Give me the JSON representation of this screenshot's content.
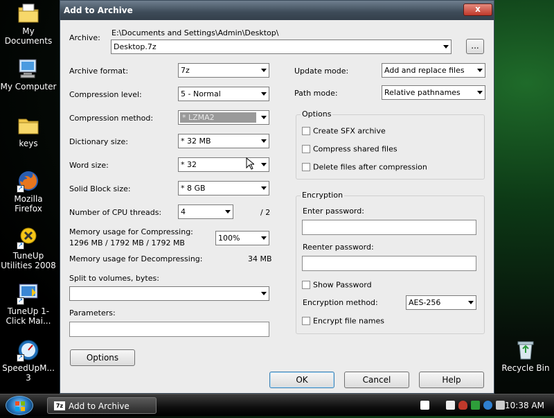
{
  "desktop": {
    "icons": [
      {
        "label": "My Documents",
        "icon": "my-documents-icon"
      },
      {
        "label": "My Computer",
        "icon": "my-computer-icon"
      },
      {
        "label": "keys",
        "icon": "folder-icon"
      },
      {
        "label": "Mozilla Firefox",
        "icon": "firefox-icon"
      },
      {
        "label": "TuneUp Utilities 2008",
        "icon": "tuneup-icon"
      },
      {
        "label": "TuneUp 1-Click Mai...",
        "icon": "tuneup-1click-icon"
      },
      {
        "label": "SpeedUpM... 3",
        "icon": "speedup-icon"
      },
      {
        "label": "Recycle Bin",
        "icon": "recycle-bin-icon"
      }
    ]
  },
  "dialog": {
    "title": "Add to Archive",
    "close_label": "x",
    "archive_label": "Archive:",
    "archive_path": "E:\\Documents and Settings\\Admin\\Desktop\\",
    "archive_name": "Desktop.7z",
    "browse_label": "...",
    "left": {
      "archive_format": {
        "label": "Archive format:",
        "value": "7z"
      },
      "compression_level": {
        "label": "Compression level:",
        "value": "5 - Normal"
      },
      "compression_method": {
        "label": "Compression method:",
        "value": "* LZMA2"
      },
      "dictionary_size": {
        "label": "Dictionary size:",
        "value": "* 32 MB"
      },
      "word_size": {
        "label": "Word size:",
        "value": "* 32"
      },
      "solid_block_size": {
        "label": "Solid Block size:",
        "value": "* 8 GB"
      },
      "cpu_threads": {
        "label": "Number of CPU threads:",
        "value": "4",
        "max": "/ 2"
      },
      "memory_compress": {
        "label": "Memory usage for Compressing:",
        "detail": "1296 MB / 1792 MB / 1792 MB",
        "value": "100%"
      },
      "memory_decompress": {
        "label": "Memory usage for Decompressing:",
        "value": "34 MB"
      },
      "split_label": "Split to volumes, bytes:",
      "split_value": "",
      "parameters_label": "Parameters:",
      "parameters_value": "",
      "options_button": "Options"
    },
    "right": {
      "update_mode": {
        "label": "Update mode:",
        "value": "Add and replace files"
      },
      "path_mode": {
        "label": "Path mode:",
        "value": "Relative pathnames"
      },
      "options_group": "Options",
      "create_sfx": "Create SFX archive",
      "compress_shared": "Compress shared files",
      "delete_after": "Delete files after compression",
      "encryption_group": "Encryption",
      "enter_password": "Enter password:",
      "reenter_password": "Reenter password:",
      "show_password": "Show Password",
      "encryption_method": {
        "label": "Encryption method:",
        "value": "AES-256"
      },
      "encrypt_names": "Encrypt file names"
    },
    "buttons": {
      "ok": "OK",
      "cancel": "Cancel",
      "help": "Help"
    }
  },
  "taskbar": {
    "task_label": "Add to Archive",
    "task_icon_text": "7z",
    "clock": "10:38 AM"
  }
}
